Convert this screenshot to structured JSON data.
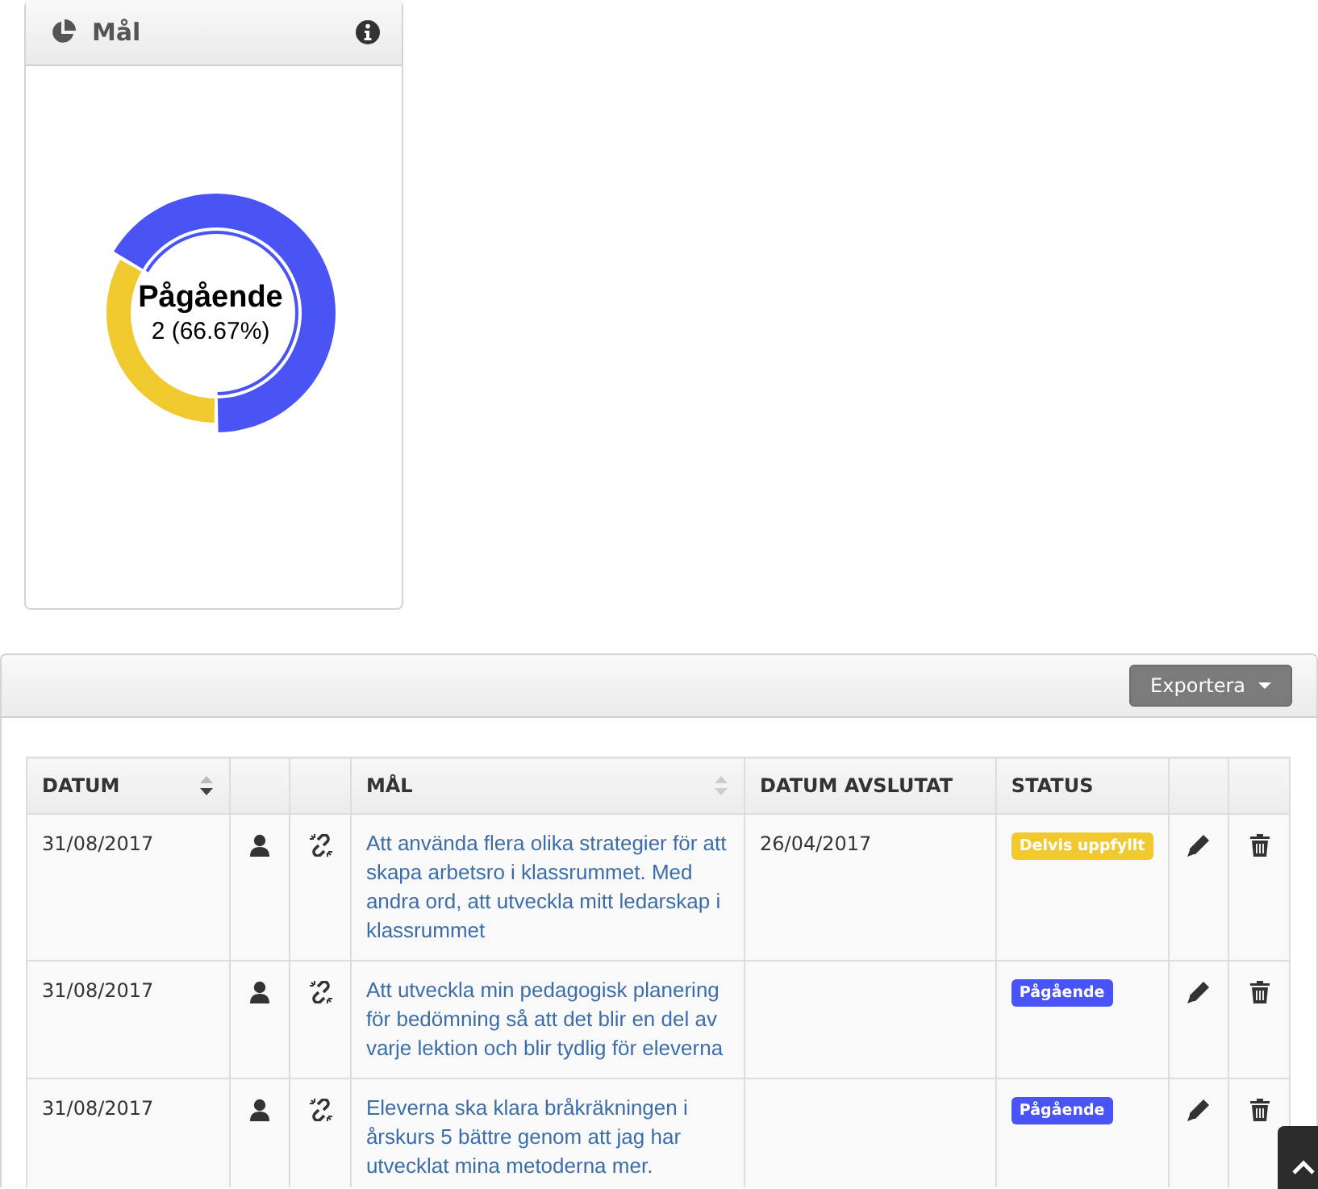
{
  "goals_widget": {
    "title": "Mål",
    "donut": {
      "chart_data": {
        "type": "donut",
        "categories": [
          null,
          "Pågående"
        ],
        "values": [
          33.33,
          66.67
        ],
        "colors": [
          "#f0c92e",
          "#4a54f4"
        ]
      },
      "center_value": "2 (66.67%)"
    }
  },
  "table_panel": {
    "export_button": "Exportera",
    "columns": [
      {
        "kind": "label",
        "label": "DATUM",
        "sortable": true,
        "sorted": true
      },
      {
        "kind": "blank"
      },
      {
        "kind": "blank"
      },
      {
        "kind": "label",
        "label": "MÅL",
        "sortable": true,
        "sorted": false
      },
      {
        "kind": "label",
        "label": "DATUM AVSLUTAT",
        "sortable": false
      },
      {
        "kind": "label",
        "label": "STATUS",
        "sortable": false
      },
      {
        "kind": "blank"
      },
      {
        "kind": "blank"
      }
    ],
    "rows": [
      {
        "date": "31/08/2017",
        "goal": "Att använda flera olika strategier för att skapa arbetsro i klassrummet. Med andra ord, att utveckla mitt ledarskap i klassrummet",
        "date_completed": "26/04/2017",
        "status": "Delvis uppfyllt",
        "color": "#f0c92e"
      },
      {
        "date": "31/08/2017",
        "goal": "Att utveckla min pedagogisk planering för bedömning så att det blir en del av varje lektion och blir tydlig för eleverna",
        "status": "Pågående",
        "color": "#4a54f4"
      },
      {
        "date": "31/08/2017",
        "goal": "Eleverna ska klara bråkräkningen i årskurs 5 bättre genom att jag har utvecklat mina metoderna mer.",
        "status": "Pågående",
        "color": "#4a54f4"
      }
    ]
  }
}
